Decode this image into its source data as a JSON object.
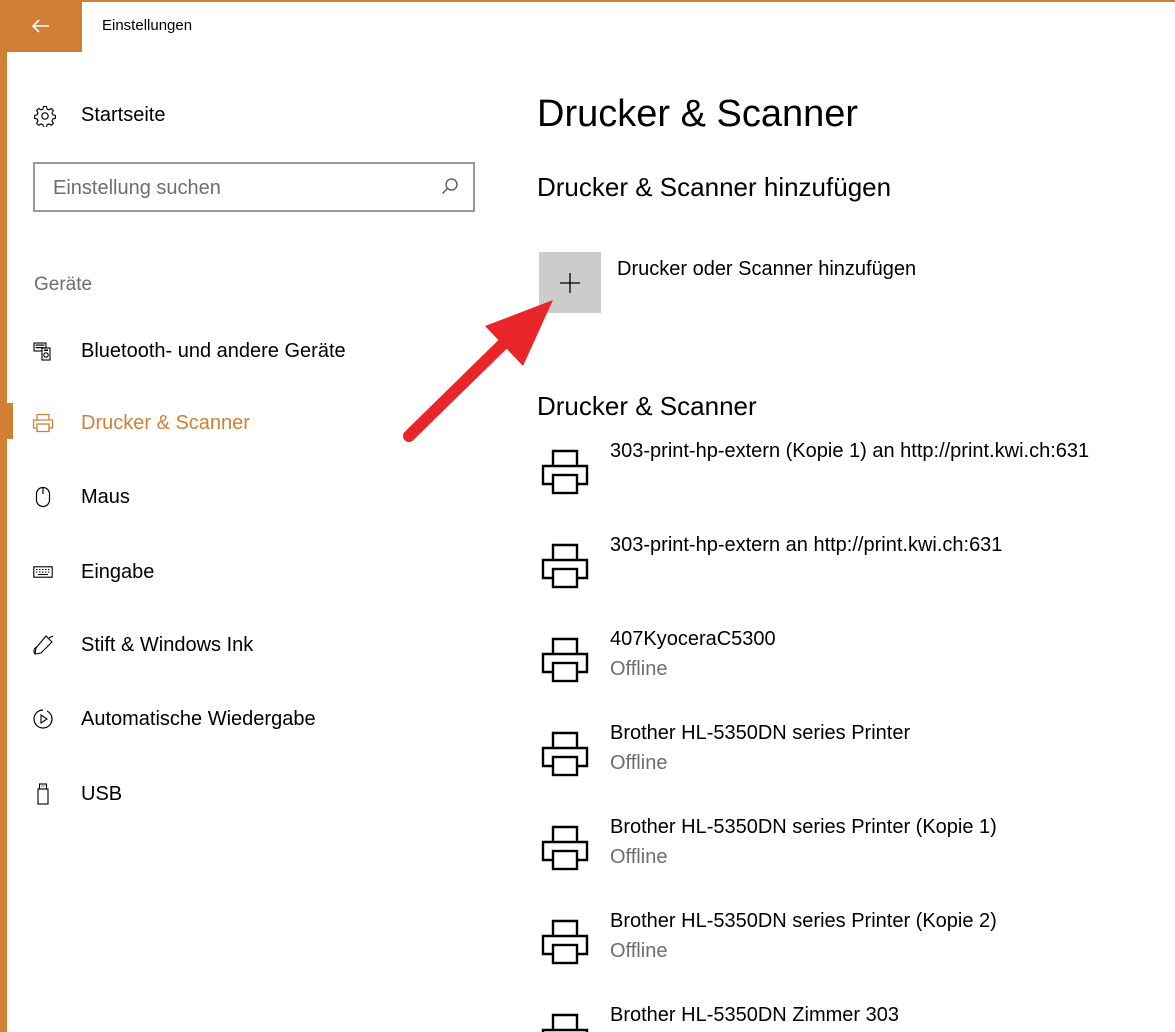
{
  "window": {
    "title": "Einstellungen"
  },
  "sidebar": {
    "home_label": "Startseite",
    "search": {
      "placeholder": "Einstellung suchen",
      "value": ""
    },
    "section_label": "Geräte",
    "items": [
      {
        "label": "Bluetooth- und andere Geräte",
        "icon": "bluetooth-devices-icon",
        "active": false
      },
      {
        "label": "Drucker & Scanner",
        "icon": "printer-icon",
        "active": true
      },
      {
        "label": "Maus",
        "icon": "mouse-icon",
        "active": false
      },
      {
        "label": "Eingabe",
        "icon": "keyboard-icon",
        "active": false
      },
      {
        "label": "Stift & Windows Ink",
        "icon": "pen-icon",
        "active": false
      },
      {
        "label": "Automatische Wiedergabe",
        "icon": "autoplay-icon",
        "active": false
      },
      {
        "label": "USB",
        "icon": "usb-icon",
        "active": false
      }
    ]
  },
  "main": {
    "title": "Drucker & Scanner",
    "add_section_title": "Drucker & Scanner hinzufügen",
    "add_button_label": "Drucker oder Scanner hinzufügen",
    "list_title": "Drucker & Scanner",
    "printers": [
      {
        "name": "303-print-hp-extern (Kopie 1) an http://print.kwi.ch:631",
        "status": ""
      },
      {
        "name": "303-print-hp-extern an http://print.kwi.ch:631",
        "status": ""
      },
      {
        "name": "407KyoceraC5300",
        "status": "Offline"
      },
      {
        "name": "Brother HL-5350DN series Printer",
        "status": "Offline"
      },
      {
        "name": "Brother HL-5350DN series Printer (Kopie 1)",
        "status": "Offline"
      },
      {
        "name": "Brother HL-5350DN series Printer (Kopie 2)",
        "status": "Offline"
      },
      {
        "name": "Brother HL-5350DN Zimmer 303",
        "status": ""
      }
    ]
  },
  "colors": {
    "accent": "#d27f36",
    "secondary_text": "#6d6d6d",
    "add_tile": "#cccccc",
    "annotation_arrow": "#e8262a"
  }
}
